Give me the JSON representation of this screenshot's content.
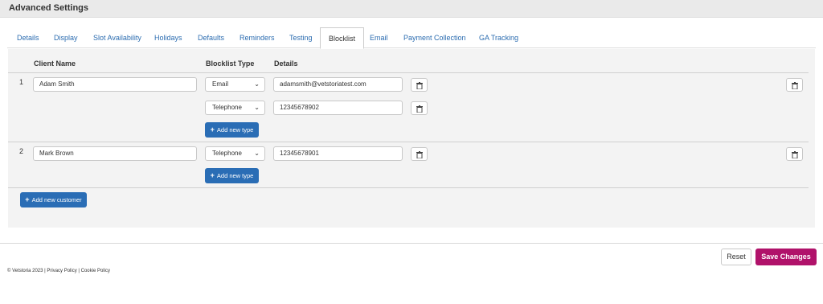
{
  "header": {
    "title": "Advanced Settings"
  },
  "tabs": [
    {
      "label": "Details"
    },
    {
      "label": "Display"
    },
    {
      "label": "Slot Availability"
    },
    {
      "label": "Holidays"
    },
    {
      "label": "Defaults"
    },
    {
      "label": "Reminders"
    },
    {
      "label": "Testing"
    },
    {
      "label": "Blocklist",
      "active": true
    },
    {
      "label": "Email"
    },
    {
      "label": "Payment Collection"
    },
    {
      "label": "GA Tracking"
    }
  ],
  "table": {
    "headers": {
      "client_name": "Client Name",
      "blocklist_type": "Blocklist Type",
      "details": "Details"
    },
    "rows": [
      {
        "number": "1",
        "client_name": "Adam Smith",
        "entries": [
          {
            "type": "Email",
            "details": "adamsmith@vetstoriatest.com"
          },
          {
            "type": "Telephone",
            "details": "12345678902"
          }
        ],
        "add_type_label": "Add new type"
      },
      {
        "number": "2",
        "client_name": "Mark Brown",
        "entries": [
          {
            "type": "Telephone",
            "details": "12345678901"
          }
        ],
        "add_type_label": "Add new type"
      }
    ],
    "add_customer_label": "Add new customer"
  },
  "actions": {
    "reset_label": "Reset",
    "save_label": "Save Changes"
  },
  "footer": {
    "copyright": "© Vetstoria 2023",
    "separator": "|",
    "privacy_label": "Privacy Policy",
    "cookie_label": "Cookie Policy"
  },
  "colors": {
    "primary_button": "#2a6db5",
    "save_button": "#b0126a",
    "tab_link": "#2b6cb0"
  },
  "icons": {
    "delete": "trash-icon",
    "dropdown": "chevron-down-icon",
    "add": "plus-icon"
  }
}
